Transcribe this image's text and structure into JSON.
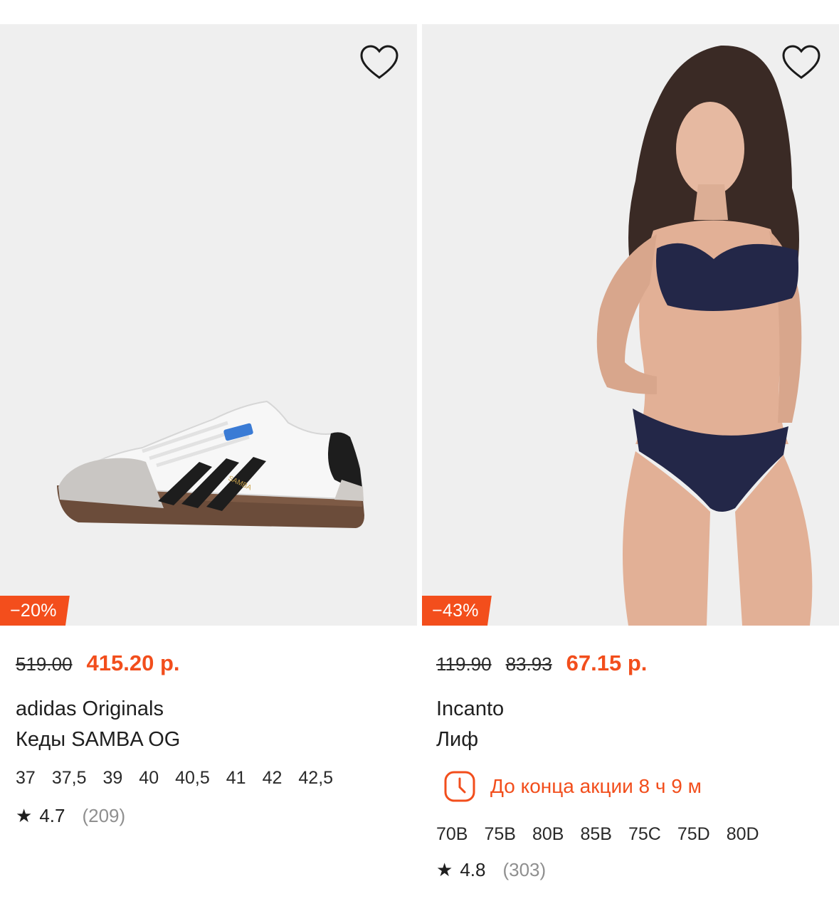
{
  "products": [
    {
      "discount": "−20%",
      "prices": {
        "old": "519.00",
        "new": "415.20 р."
      },
      "brand": "adidas Originals",
      "title": "Кеды SAMBA OG",
      "sizes": [
        "37",
        "37,5",
        "39",
        "40",
        "40,5",
        "41",
        "42",
        "42,5"
      ],
      "rating": "4.7",
      "reviews": "(209)",
      "image": "sneaker-photo"
    },
    {
      "discount": "−43%",
      "prices": {
        "old": "119.90",
        "old2": "83.93",
        "new": "67.15 р."
      },
      "brand": "Incanto",
      "title": "Лиф",
      "timer": "До конца акции 8 ч 9 м",
      "sizes": [
        "70B",
        "75B",
        "80B",
        "85B",
        "75C",
        "75D",
        "80D"
      ],
      "rating": "4.8",
      "reviews": "(303)",
      "image": "model-photo"
    }
  ],
  "colors": {
    "accent": "#f24e1c",
    "badge": "#f34e1c",
    "photo_bg": "#efefef",
    "muted": "#8f8f8f"
  },
  "icons": {
    "favorite": "heart-outline-icon",
    "timer": "clock-icon",
    "rating": "star-icon"
  }
}
